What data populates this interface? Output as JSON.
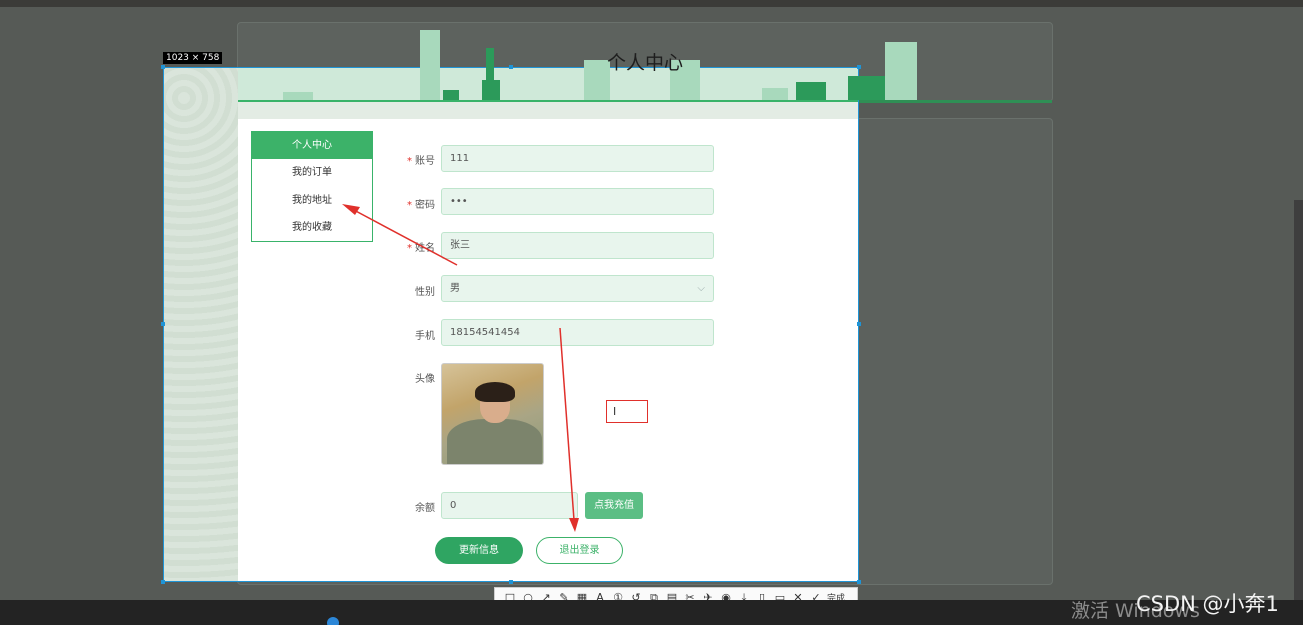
{
  "page": {
    "title": "个人中心",
    "size_label": "1023 × 758"
  },
  "menu": {
    "items": [
      {
        "label": "个人中心",
        "active": true
      },
      {
        "label": "我的订单",
        "active": false
      },
      {
        "label": "我的地址",
        "active": false
      },
      {
        "label": "我的收藏",
        "active": false
      }
    ]
  },
  "form": {
    "account": {
      "label": "账号",
      "value": "111",
      "required": true
    },
    "password": {
      "label": "密码",
      "value": "•••",
      "required": true
    },
    "name": {
      "label": "姓名",
      "value": "张三",
      "required": true
    },
    "gender": {
      "label": "性别",
      "value": "男"
    },
    "phone": {
      "label": "手机",
      "value": "18154541454"
    },
    "avatar": {
      "label": "头像"
    },
    "balance": {
      "label": "余额",
      "value": "0"
    },
    "recharge_button": "点我充值",
    "update_button": "更新信息",
    "logout_button": "退出登录"
  },
  "toolbar": {
    "icons": [
      "rect-icon",
      "ellipse-icon",
      "arrow-icon",
      "pen-icon",
      "mosaic-icon",
      "text-icon",
      "number-icon",
      "undo-icon",
      "screenshot-icon",
      "ocr-icon",
      "long-screenshot-icon",
      "pin-icon",
      "record-icon",
      "save-icon",
      "copy-icon",
      "bookmark-icon",
      "close-icon",
      "check-icon"
    ],
    "done_label": "完成",
    "font_size": "12",
    "current_color": "#e8302b"
  },
  "watermark": {
    "activate_text": "激活 Windows",
    "csdn_text": "CSDN @小奔1"
  },
  "colors": {
    "brand_green": "#3cb269",
    "annotation_red": "#e0302b",
    "selection_blue": "#1f94d6"
  }
}
